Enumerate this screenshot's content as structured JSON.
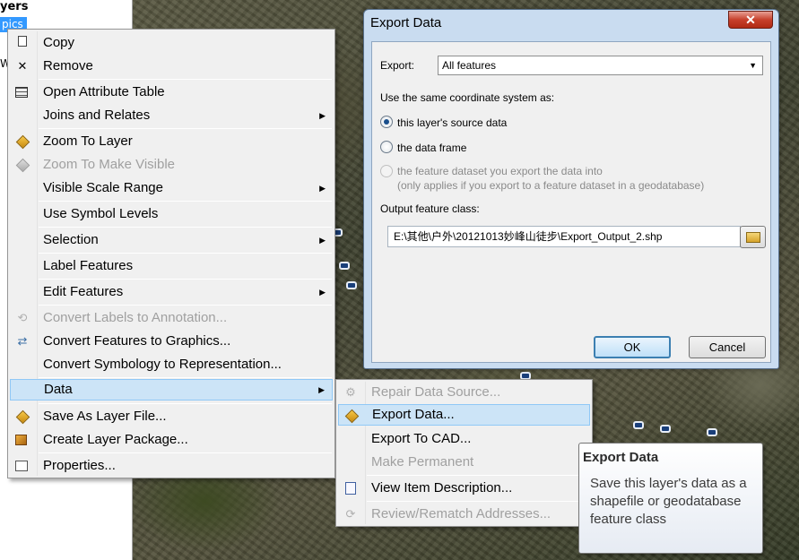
{
  "toc": {
    "title": "yers",
    "selected": "pics",
    "partial": "W"
  },
  "context_menu": {
    "items": [
      {
        "label": "Copy",
        "icon": "copy-icon",
        "enabled": true
      },
      {
        "label": "Remove",
        "icon": "remove-icon",
        "enabled": true
      },
      {
        "label": "Open Attribute Table",
        "icon": "table-icon",
        "enabled": true
      },
      {
        "label": "Joins and Relates",
        "submenu": true,
        "enabled": true
      },
      {
        "label": "Zoom To Layer",
        "icon": "zoom-layer-icon",
        "enabled": true
      },
      {
        "label": "Zoom To Make Visible",
        "icon": "zoom-visible-icon",
        "enabled": false
      },
      {
        "label": "Visible Scale Range",
        "submenu": true,
        "enabled": true
      },
      {
        "label": "Use Symbol Levels",
        "enabled": true
      },
      {
        "label": "Selection",
        "submenu": true,
        "enabled": true
      },
      {
        "label": "Label Features",
        "enabled": true
      },
      {
        "label": "Edit Features",
        "submenu": true,
        "enabled": true
      },
      {
        "label": "Convert Labels to Annotation...",
        "icon": "convert-labels-icon",
        "enabled": false
      },
      {
        "label": "Convert Features to Graphics...",
        "icon": "convert-graphics-icon",
        "enabled": true
      },
      {
        "label": "Convert Symbology to Representation...",
        "enabled": true
      },
      {
        "label": "Data",
        "submenu": true,
        "enabled": true,
        "active": true
      },
      {
        "label": "Save As Layer File...",
        "icon": "layer-file-icon",
        "enabled": true
      },
      {
        "label": "Create Layer Package...",
        "icon": "layer-package-icon",
        "enabled": true
      },
      {
        "label": "Properties...",
        "icon": "properties-icon",
        "enabled": true
      }
    ]
  },
  "data_submenu": {
    "items": [
      {
        "label": "Repair Data Source...",
        "icon": "repair-icon",
        "enabled": false
      },
      {
        "label": "Export Data...",
        "icon": "export-icon",
        "enabled": true,
        "active": true
      },
      {
        "label": "Export To CAD...",
        "enabled": true
      },
      {
        "label": "Make Permanent",
        "enabled": false
      },
      {
        "label": "View Item Description...",
        "icon": "description-icon",
        "enabled": true
      },
      {
        "label": "Review/Rematch Addresses...",
        "icon": "rematch-icon",
        "enabled": false
      }
    ]
  },
  "dialog": {
    "title": "Export Data",
    "close_label": "✕",
    "export_label": "Export:",
    "export_value": "All features",
    "coord_label": "Use the same coordinate system as:",
    "opt_source": "this layer's source data",
    "opt_frame": "the data frame",
    "opt_dataset": "the feature dataset you export the data into",
    "opt_dataset_note": "(only applies if you export to a feature dataset in a geodatabase)",
    "output_label": "Output feature class:",
    "output_path": "E:\\其他\\户外\\20121013妙峰山徒步\\Export_Output_2.shp",
    "ok_label": "OK",
    "cancel_label": "Cancel"
  },
  "tooltip": {
    "title": "Export Data",
    "body": "Save this layer's data as a shapefile or geodatabase feature class"
  }
}
